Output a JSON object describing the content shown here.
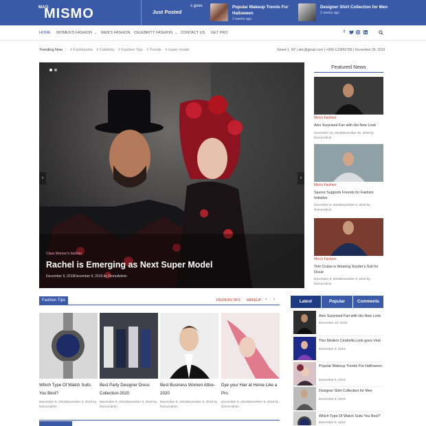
{
  "brand": {
    "mag": "MAG",
    "name": "MISMO"
  },
  "ticker": {
    "label": "Just Posted",
    "partial": "s goes",
    "items": [
      {
        "title": "Popular Makeup Trends For Halloween",
        "date": "2 weeks ago"
      },
      {
        "title": "Designer Shirt Collection for Men",
        "date": "2 weeks ago"
      }
    ]
  },
  "nav": {
    "items": [
      {
        "label": "HOME",
        "caret": ""
      },
      {
        "label": "WOMEN'S FASHION",
        "caret": "⌄"
      },
      {
        "label": "MEN'S FASHION",
        "caret": ""
      },
      {
        "label": "CELEBRITY FASHION",
        "caret": "⌄"
      },
      {
        "label": "CONTACT US",
        "caret": ""
      },
      {
        "label": "GET PRO",
        "caret": ""
      }
    ],
    "social": [
      "f",
      "t",
      "ig",
      "in"
    ],
    "search_icon": "search-icon"
  },
  "trending": {
    "label": "Trending Now",
    "tags": [
      "# Fashionista",
      "# Celebrity",
      "# Fashion Tips",
      "# Trends",
      "# super model"
    ]
  },
  "contact": {
    "address": "Street-1, NY",
    "email": "abc@gmail.com",
    "phone": "+999-123456789",
    "date": "December 26, 2019"
  },
  "hero": {
    "categories": "Class    Women's fashion",
    "title": "Rachel is Emerging as Next Super Model",
    "meta": "December 9, 2019December 9, 2019 by DemoAdmin"
  },
  "featured": {
    "heading": "Featured News",
    "items": [
      {
        "category": "Men's Fashion",
        "title": "Alex Surprised Fan with His New Look",
        "meta": "December 10, 2019December 25, 2019 by DemoAdmin"
      },
      {
        "category": "Men's Fashion",
        "title": "Saurez Supports Forests for Fashion Initiative",
        "meta": "December 5, 2019December 9, 2019 by DemoAdmin"
      },
      {
        "category": "Men's Fashion",
        "title": "Tom Cruise is Wearing Snyder's Suit for Oscar",
        "meta": "December 9, 2019December 9, 2019 by DemoAdmin"
      }
    ]
  },
  "tips": {
    "label": "Fashion Tips",
    "links": [
      "FASHION-TIPS",
      "MAKEUP"
    ],
    "prev": "‹",
    "next": "›",
    "cards": [
      {
        "title": "Which Type Of Watch Suits You Best?",
        "meta": "December 9, 2019December 9, 2019 by DemoAdmin"
      },
      {
        "title": "Best Party Designer Dress Collection-2020",
        "meta": "December 9, 2019December 9, 2019 by DemoAdmin"
      },
      {
        "title": "Best Business Women Attire-2020",
        "meta": "December 9, 2019December 9, 2019 by DemoAdmin"
      },
      {
        "title": "Dye your Hair at Home Like a Pro",
        "meta": "December 9, 2019December 9, 2019 by DemoAdmin"
      }
    ]
  },
  "sidebar_tabs": {
    "tabs": [
      "Latest",
      "Popular",
      "Comments"
    ],
    "items": [
      {
        "title": "Alex Surprised Fan with His New Look",
        "date": "December 10, 2019"
      },
      {
        "title": "This Modern Cindrella Look goes Viral",
        "date": "December 9, 2019"
      },
      {
        "title": "Popular Makeup Trends For Halloween",
        "date": "December 9, 2019"
      },
      {
        "title": "Designer Shirt Collection for Men",
        "date": "December 9, 2019"
      },
      {
        "title": "Which Type Of Watch Suits You Best?",
        "date": "December 9, 2019"
      }
    ]
  },
  "colors": {
    "brand": "#3a5aa8",
    "tab_active": "#1e3a82",
    "accent_red": "#c0392b"
  }
}
